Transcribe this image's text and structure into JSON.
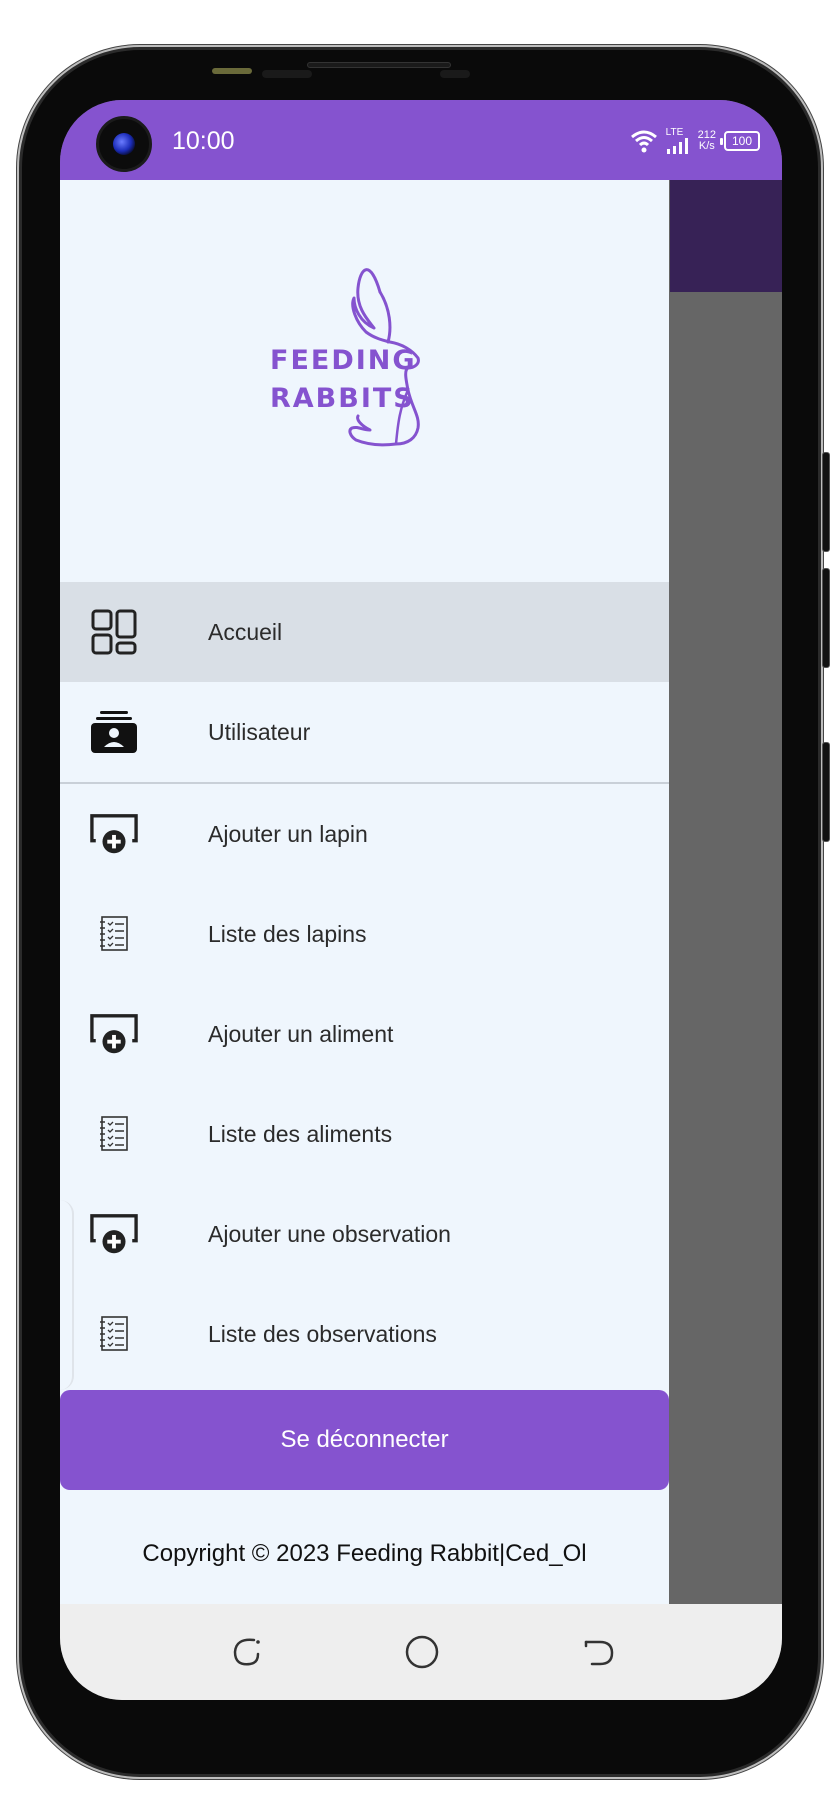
{
  "status_bar": {
    "time": "10:00",
    "network": "LTE",
    "speed_value": "212",
    "speed_unit": "K/s",
    "battery": "100"
  },
  "drawer": {
    "logo_line1": "FEEDING",
    "logo_line2": "RABBITS",
    "items": [
      {
        "label": "Accueil",
        "icon": "dashboard-icon",
        "active": true
      },
      {
        "label": "Utilisateur",
        "icon": "user-card-icon",
        "active": false
      },
      {
        "label": "Ajouter un lapin",
        "icon": "add-screen-icon",
        "active": false
      },
      {
        "label": "Liste des lapins",
        "icon": "checklist-icon",
        "active": false
      },
      {
        "label": "Ajouter un aliment",
        "icon": "add-screen-icon",
        "active": false
      },
      {
        "label": "Liste des aliments",
        "icon": "checklist-icon",
        "active": false
      },
      {
        "label": "Ajouter une observation",
        "icon": "add-screen-icon",
        "active": false
      },
      {
        "label": "Liste des observations",
        "icon": "checklist-icon",
        "active": false
      }
    ],
    "logout_label": "Se déconnecter",
    "footer": "Copyright © 2023 Feeding Rabbit|Ced_Ol"
  },
  "colors": {
    "accent": "#8553cf",
    "appbar": "#372256",
    "drawer_bg": "#eff6fd",
    "scrim": "#666666"
  }
}
